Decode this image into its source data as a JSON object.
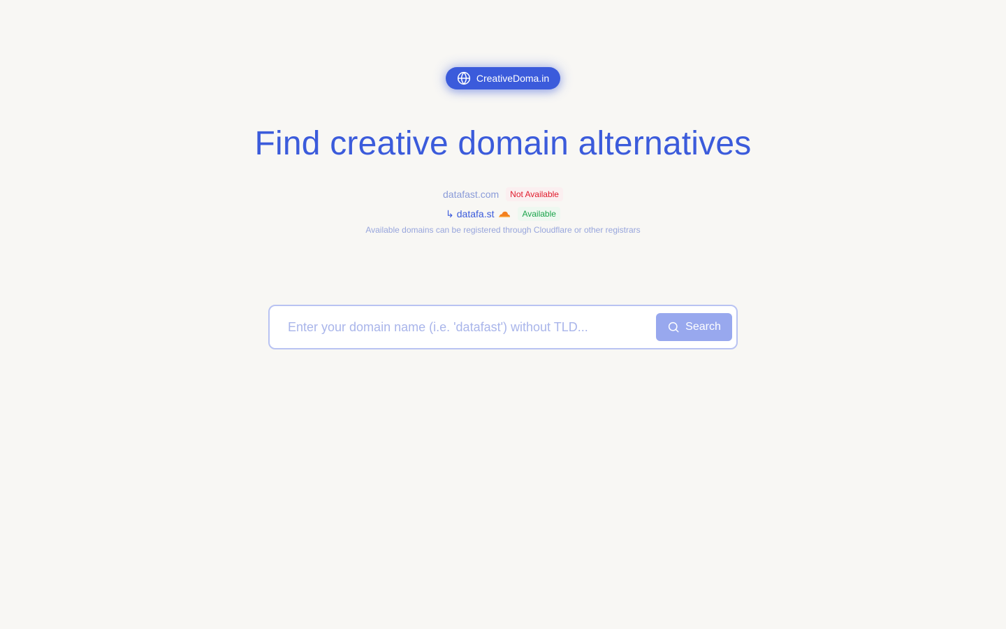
{
  "brand": {
    "name": "CreativeDoma.in",
    "icon": "globe-icon"
  },
  "hero": {
    "title": "Find creative domain alternatives"
  },
  "example": {
    "original_domain": "datafast.com",
    "original_status": "Not Available",
    "alt_arrow": "↳",
    "alt_domain": "datafa.st",
    "alt_registrar_icon": "cloudflare-icon",
    "alt_status": "Available",
    "note": "Available domains can be registered through Cloudflare or other registrars"
  },
  "search": {
    "placeholder": "Enter your domain name (i.e. 'datafast') without TLD...",
    "value": "",
    "button_label": "Search",
    "button_icon": "search-icon"
  },
  "colors": {
    "accent": "#3b5bdb",
    "background": "#f8f7f4",
    "unavailable": "#e01a2b",
    "available": "#1aa34a",
    "cloudflare": "#f38020"
  }
}
